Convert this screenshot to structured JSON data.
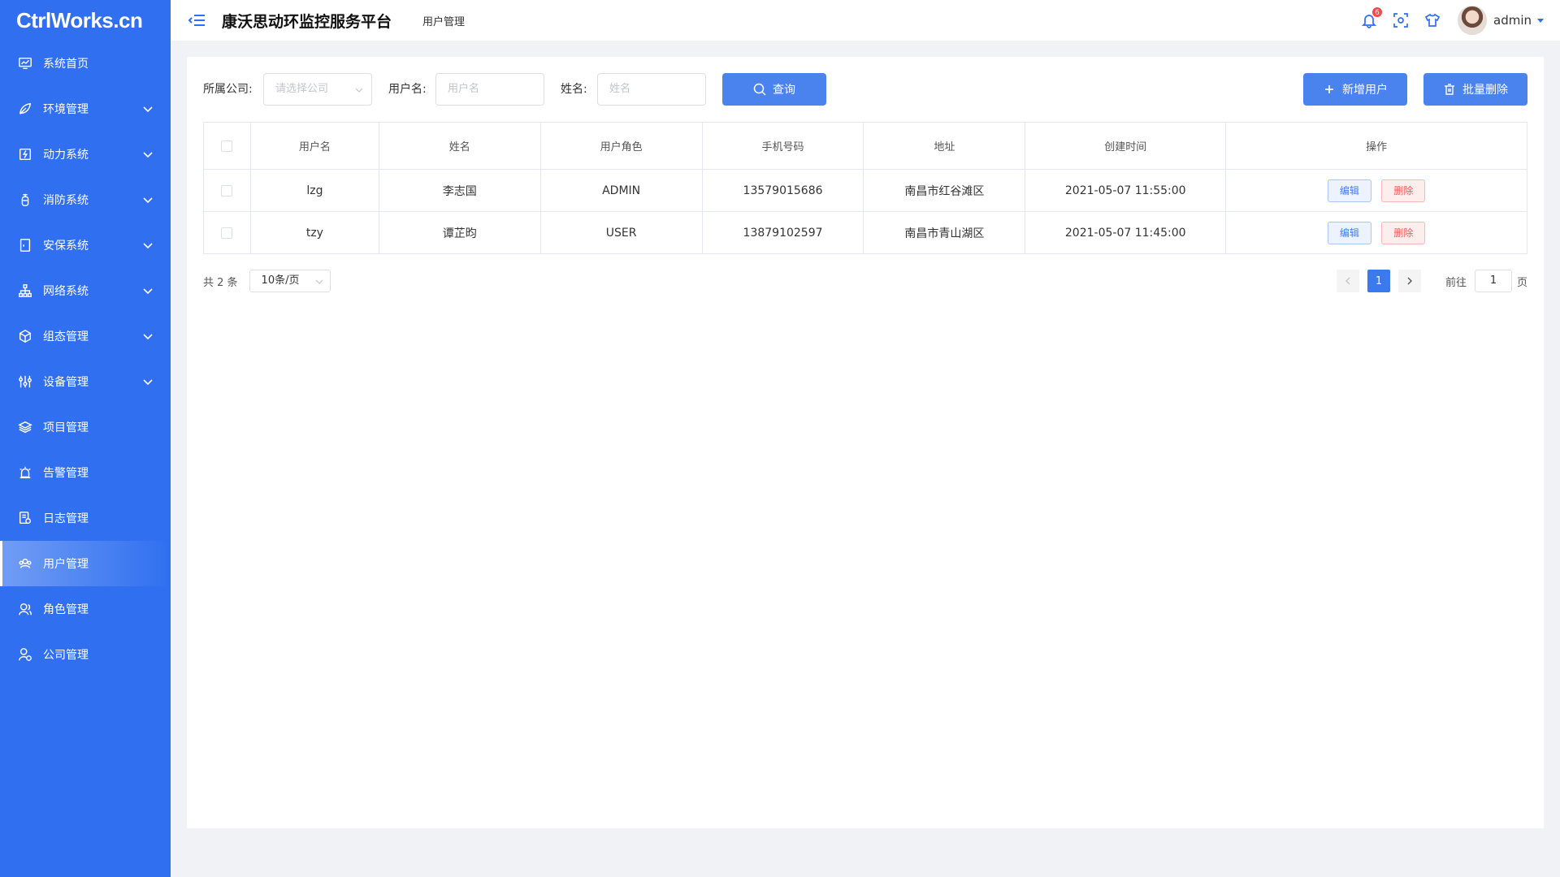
{
  "logo": "CtrlWorks.cn",
  "header": {
    "title": "康沃思动环监控服务平台",
    "breadcrumb": "用户管理",
    "notification_count": "6",
    "username": "admin"
  },
  "sidebar": {
    "items": [
      {
        "label": "系统首页",
        "icon": "monitor-chart-icon",
        "expandable": false
      },
      {
        "label": "环境管理",
        "icon": "leaf-icon",
        "expandable": true
      },
      {
        "label": "动力系统",
        "icon": "power-icon",
        "expandable": true
      },
      {
        "label": "消防系统",
        "icon": "fire-extinguisher-icon",
        "expandable": true
      },
      {
        "label": "安保系统",
        "icon": "security-door-icon",
        "expandable": true
      },
      {
        "label": "网络系统",
        "icon": "network-icon",
        "expandable": true
      },
      {
        "label": "组态管理",
        "icon": "cube-icon",
        "expandable": true
      },
      {
        "label": "设备管理",
        "icon": "sliders-icon",
        "expandable": true
      },
      {
        "label": "项目管理",
        "icon": "layers-icon",
        "expandable": false
      },
      {
        "label": "告警管理",
        "icon": "alarm-icon",
        "expandable": false
      },
      {
        "label": "日志管理",
        "icon": "log-icon",
        "expandable": false
      },
      {
        "label": "用户管理",
        "icon": "users-icon",
        "expandable": false,
        "active": true
      },
      {
        "label": "角色管理",
        "icon": "role-icon",
        "expandable": false
      },
      {
        "label": "公司管理",
        "icon": "company-user-icon",
        "expandable": false
      }
    ]
  },
  "filters": {
    "company_label": "所属公司:",
    "company_placeholder": "请选择公司",
    "username_label": "用户名:",
    "username_placeholder": "用户名",
    "name_label": "姓名:",
    "name_placeholder": "姓名",
    "search_button": "查询",
    "add_button": "新增用户",
    "batch_delete_button": "批量删除"
  },
  "table": {
    "columns": [
      "用户名",
      "姓名",
      "用户角色",
      "手机号码",
      "地址",
      "创建时间",
      "操作"
    ],
    "rows": [
      {
        "username": "lzg",
        "name": "李志国",
        "role": "ADMIN",
        "phone": "13579015686",
        "address": "南昌市红谷滩区",
        "created": "2021-05-07 11:55:00"
      },
      {
        "username": "tzy",
        "name": "谭芷昀",
        "role": "USER",
        "phone": "13879102597",
        "address": "南昌市青山湖区",
        "created": "2021-05-07 11:45:00"
      }
    ],
    "edit_label": "编辑",
    "delete_label": "删除"
  },
  "pagination": {
    "total_text": "共 2 条",
    "page_size": "10条/页",
    "current_page": "1",
    "goto_label": "前往",
    "goto_value": "1",
    "goto_unit": "页"
  },
  "colors": {
    "sidebar": "#2f6ff0",
    "primary": "#4b83ee",
    "danger": "#f05b5b"
  }
}
